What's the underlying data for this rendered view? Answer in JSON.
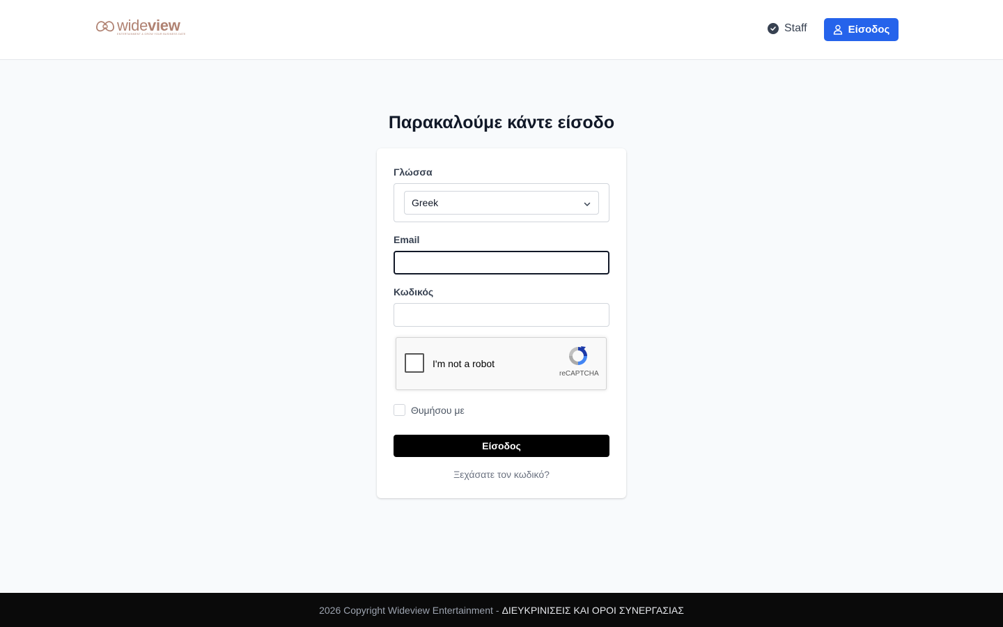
{
  "header": {
    "logo": {
      "word_light": "wide",
      "word_bold": "view",
      "tagline": "ENTERTAINMENT & GROW YOUR BUSINESS DATE",
      "color": "#b08272"
    },
    "staff_link": {
      "label": "Staff",
      "icon": "check-circle-icon"
    },
    "login_button": {
      "label": "Είσοδος",
      "icon": "user-icon",
      "color": "#2563eb"
    }
  },
  "page": {
    "title": "Παρακαλούμε κάντε είσοδο"
  },
  "form": {
    "language": {
      "label": "Γλώσσα",
      "selected": "Greek"
    },
    "email": {
      "label": "Email",
      "value": ""
    },
    "password": {
      "label": "Κωδικός",
      "value": ""
    },
    "recaptcha": {
      "text": "I'm not a robot",
      "brand": "reCAPTCHA"
    },
    "remember": {
      "label": "Θυμήσου με",
      "checked": false
    },
    "submit_label": "Είσοδος",
    "forgot_label": "Ξεχάσατε τον κωδικό?"
  },
  "footer": {
    "copyright": "2026 Copyright Wideview Entertainment",
    "separator": "-",
    "terms_link": "ΔΙΕΥΚΡΙΝΙΣΕΙΣ ΚΑΙ ΟΡΟΙ ΣΥΝΕΡΓΑΣΙΑΣ"
  }
}
